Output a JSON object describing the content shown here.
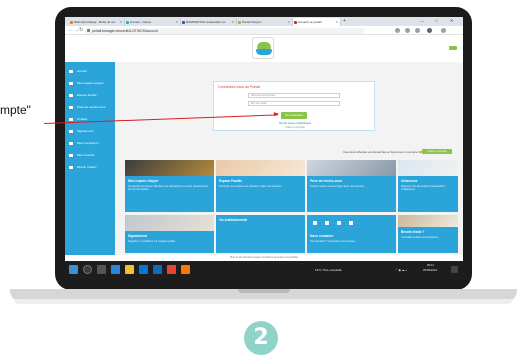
{
  "browser": {
    "tabs": [
      {
        "label": "Webmail Orange - Boîte de réc",
        "favicon_color": "#ff7900"
      },
      {
        "label": "Accueil - Canva",
        "favicon_color": "#00c4cc"
      },
      {
        "label": "NOMINATION restauration sc",
        "favicon_color": "#3b5998"
      },
      {
        "label": "Portail Citoyen",
        "favicon_color": "#8bc34a"
      },
      {
        "label": "Accueil | le portail",
        "favicon_color": "#c62828"
      }
    ],
    "new_tab": "+",
    "window_controls": [
      "—",
      "□",
      "✕"
    ],
    "url": "portail.benagen-leucenth/LOTWOS/account"
  },
  "page": {
    "login": {
      "title": "Connectez-vous au Portail",
      "email_placeholder": "Adresse électronique",
      "password_placeholder": "Mot de passe",
      "submit_label": "Se connecter",
      "forgot_label": "Mot de passe oublié/bloqué",
      "create_label": "Créer un compte"
    },
    "sidebar": [
      "Accueil",
      "Mon espace citoyen",
      "Espace famille",
      "Prise de rendez-vous",
      "Contact",
      "Signalement",
      "Mes inscriptions",
      "Mes contacts",
      "Besoin d'aide?"
    ],
    "note_text": "Vous avez effectué vos démarches en ligne avec un compte Ville",
    "note_button": "Créer un compte",
    "cards": [
      {
        "title": "Mon espace citoyen",
        "text": "Connectez-vous pour effectuer vos démarches et suivre l'avancement de vos demandes."
      },
      {
        "title": "Espace Famille",
        "text": "Inscrivez vos enfants aux activités, réglez vos factures."
      },
      {
        "title": "Prise de rendez-vous",
        "text": "Prenez rendez-vous en ligne avec nos services."
      },
      {
        "title": "Urbanisme",
        "text": "Déposez vos demandes d'autorisation d'urbanisme."
      },
      {
        "title": "Signalement",
        "text": "Signalez un problème sur l'espace public."
      },
      {
        "title": "Vie institutionnelle",
        "text": ""
      },
      {
        "title": "Nous contacter",
        "text": "Une question ? Contactez nos services."
      },
      {
        "title": "Besoin d'aide ?",
        "text": "Consultez la foire aux questions."
      }
    ],
    "footer": "Plan du site   Mentions légales   Conditions générales   Accessibilité"
  },
  "taskbar": {
    "temperature": "19°C  Très ensoleillé",
    "time": "09:11",
    "date": "26/06/2024"
  },
  "annotation": {
    "label": "mpte\"",
    "step_number": "2",
    "arrow_color": "#d91e1e",
    "step_color": "#8fd3c9"
  }
}
